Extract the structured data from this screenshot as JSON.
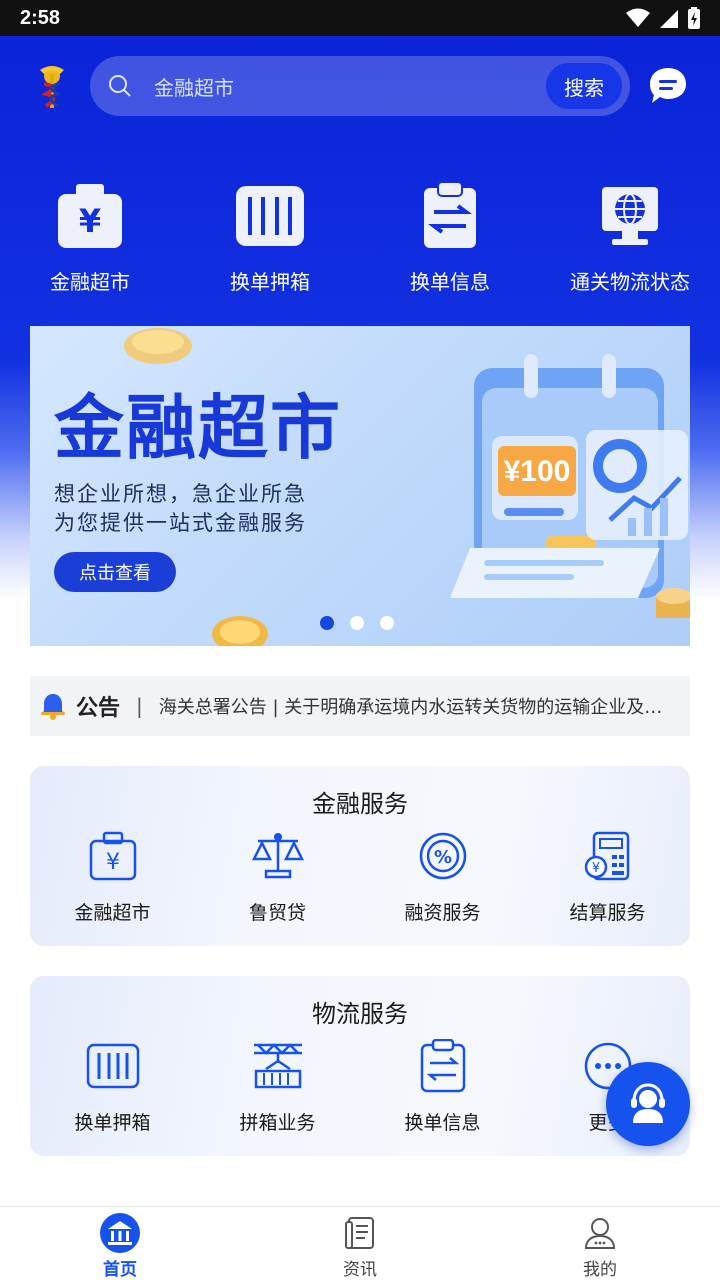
{
  "status_bar": {
    "time": "2:58"
  },
  "header": {
    "search_placeholder": "金融超市",
    "search_button": "搜索"
  },
  "quick_menu": [
    {
      "label": "金融超市",
      "icon": "wallet-yen-icon"
    },
    {
      "label": "换单押箱",
      "icon": "container-icon"
    },
    {
      "label": "换单信息",
      "icon": "clipboard-exchange-icon"
    },
    {
      "label": "通关物流状态",
      "icon": "monitor-globe-icon"
    }
  ],
  "banner": {
    "title": "金融超市",
    "subtitle_line1": "想企业所想，急企业所急",
    "subtitle_line2": "为您提供一站式金融服务",
    "button": "点击查看",
    "card_amount": "¥100",
    "slides_total": 3,
    "slide_active": 1
  },
  "notice": {
    "title": "公告",
    "separator": "|",
    "text": "海关总署公告 | 关于明确承运境内水运转关货物的运输企业及其船舶的条件..."
  },
  "finance_services": {
    "title": "金融服务",
    "items": [
      {
        "label": "金融超市",
        "icon": "wallet-yen-icon"
      },
      {
        "label": "鲁贸贷",
        "icon": "scale-icon"
      },
      {
        "label": "融资服务",
        "icon": "percent-circle-icon"
      },
      {
        "label": "结算服务",
        "icon": "calculator-icon"
      }
    ]
  },
  "logistics_services": {
    "title": "物流服务",
    "items": [
      {
        "label": "换单押箱",
        "icon": "container-icon"
      },
      {
        "label": "拼箱业务",
        "icon": "crane-container-icon"
      },
      {
        "label": "换单信息",
        "icon": "clipboard-exchange-icon"
      },
      {
        "label": "更多",
        "icon": "more-dots-icon"
      }
    ]
  },
  "tabbar": [
    {
      "label": "首页",
      "icon": "home-bank-icon"
    },
    {
      "label": "资讯",
      "icon": "news-icon"
    },
    {
      "label": "我的",
      "icon": "user-icon"
    }
  ],
  "colors": {
    "primary": "#1652ee",
    "header_blue": "#1231e0"
  }
}
